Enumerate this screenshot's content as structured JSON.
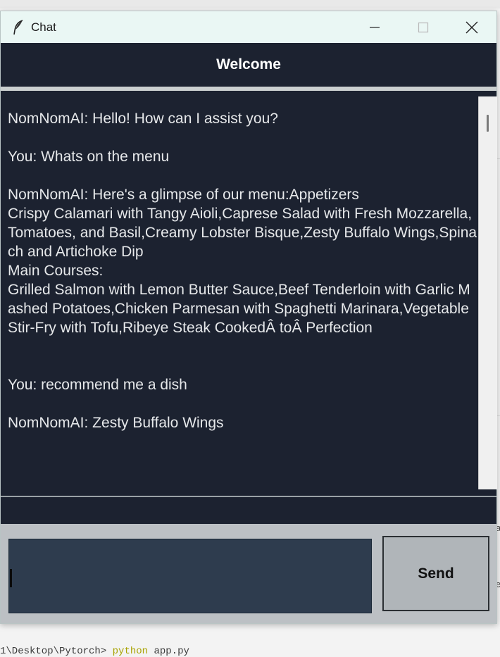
{
  "window": {
    "title": "Chat",
    "icon": "feather-icon"
  },
  "header": {
    "title": "Welcome"
  },
  "chat": {
    "transcript": "NomNomAI: Hello! How can I assist you?\n\nYou: Whats on the menu\n\nNomNomAI: Here's a glimpse of our menu:Appetizers\nCrispy Calamari with Tangy Aioli,Caprese Salad with Fresh Mozzarella, Tomatoes, and Basil,Creamy Lobster Bisque,Zesty Buffalo Wings,Spinach and Artichoke Dip\nMain Courses:\nGrilled Salmon with Lemon Butter Sauce,Beef Tenderloin with Garlic Mashed Potatoes,Chicken Parmesan with Spaghetti Marinara,Vegetable Stir-Fry with Tofu,Ribeye Steak CookedÂ toÂ Perfection\n\n\nYou: recommend me a dish\n\nNomNomAI: Zesty Buffalo Wings"
  },
  "input": {
    "value": ""
  },
  "send": {
    "label": "Send"
  },
  "background": {
    "side_char_a": "a",
    "side_char_b": "e",
    "terminal_prefix": "1\\Desktop\\Pytorch> ",
    "terminal_cmd": "python",
    "terminal_rest": " app.py"
  },
  "colors": {
    "window_bg": "#1c2230",
    "titlebar_bg": "#eaf7f4",
    "input_bg": "#2e3c4e",
    "panel_bg": "#bcc0c4",
    "button_bg": "#b0b5b9"
  }
}
